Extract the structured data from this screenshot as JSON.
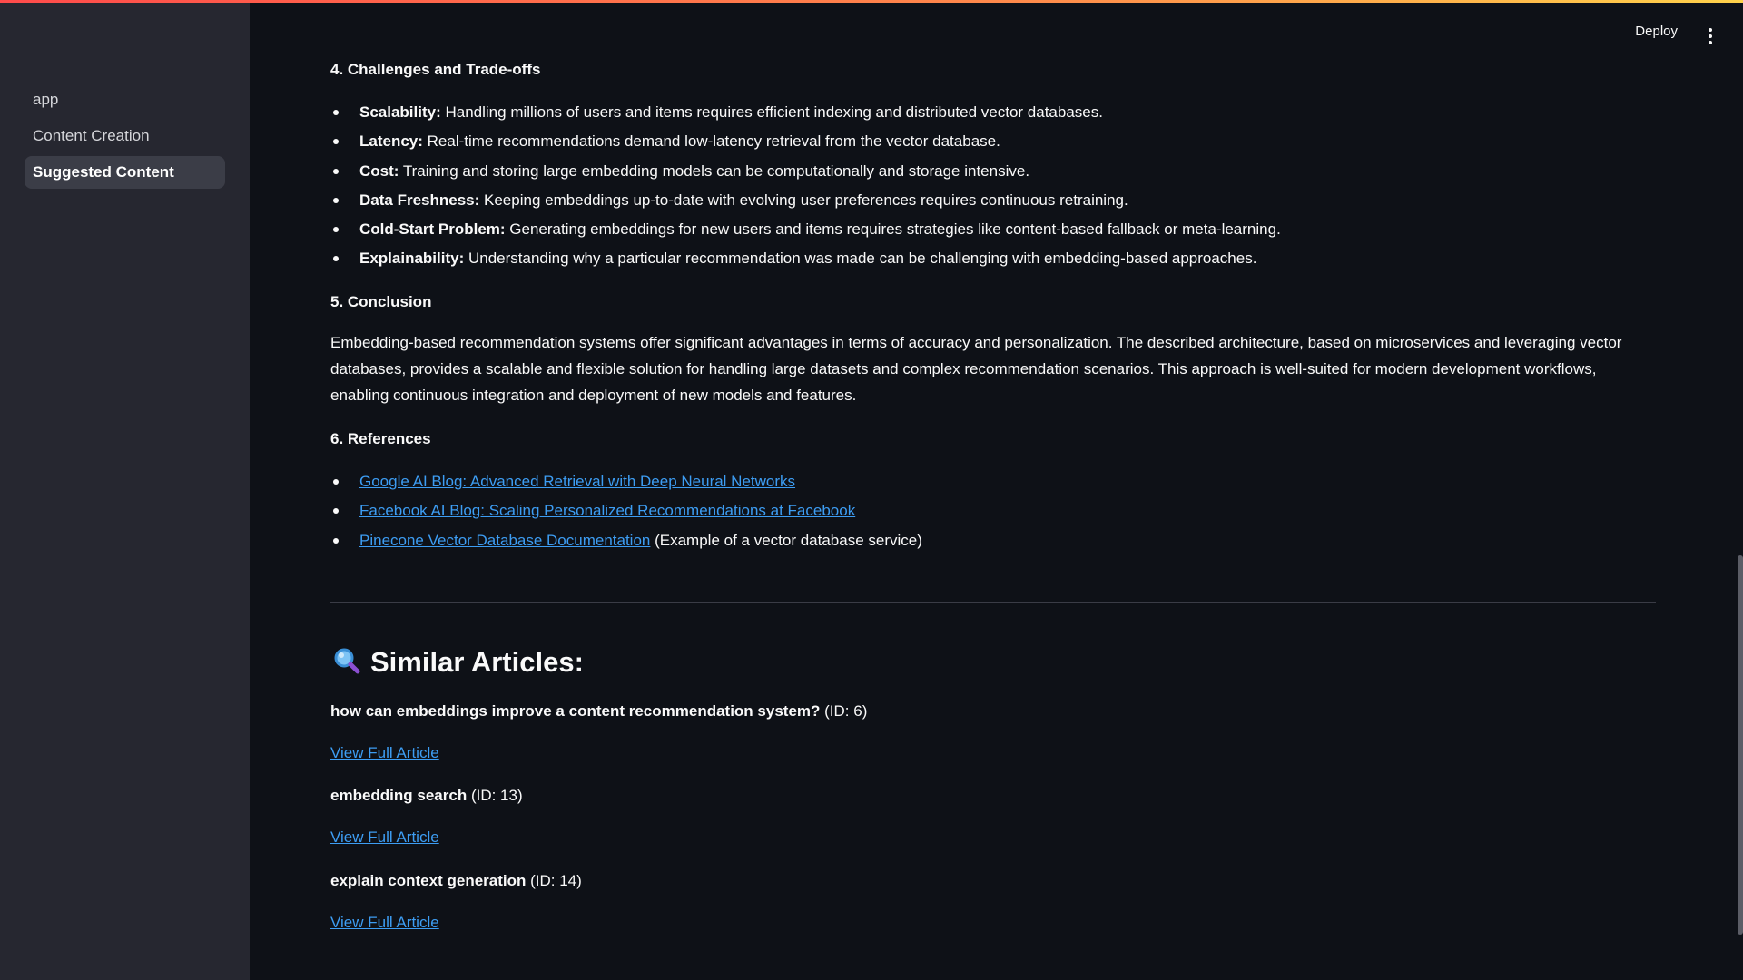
{
  "sidebar": {
    "items": [
      {
        "label": "app",
        "active": false
      },
      {
        "label": "Content Creation",
        "active": false
      },
      {
        "label": "Suggested Content",
        "active": true
      }
    ]
  },
  "header": {
    "deploy_label": "Deploy"
  },
  "sections": {
    "challenges": {
      "title": "4. Challenges and Trade-offs",
      "items": [
        {
          "term": "Scalability:",
          "text": " Handling millions of users and items requires efficient indexing and distributed vector databases."
        },
        {
          "term": "Latency:",
          "text": " Real-time recommendations demand low-latency retrieval from the vector database."
        },
        {
          "term": "Cost:",
          "text": " Training and storing large embedding models can be computationally and storage intensive."
        },
        {
          "term": "Data Freshness:",
          "text": " Keeping embeddings up-to-date with evolving user preferences requires continuous retraining."
        },
        {
          "term": "Cold-Start Problem:",
          "text": " Generating embeddings for new users and items requires strategies like content-based fallback or meta-learning."
        },
        {
          "term": "Explainability:",
          "text": " Understanding why a particular recommendation was made can be challenging with embedding-based approaches."
        }
      ]
    },
    "conclusion": {
      "title": "5. Conclusion",
      "text": "Embedding-based recommendation systems offer significant advantages in terms of accuracy and personalization. The described architecture, based on microservices and leveraging vector databases, provides a scalable and flexible solution for handling large datasets and complex recommendation scenarios. This approach is well-suited for modern development workflows, enabling continuous integration and deployment of new models and features."
    },
    "references": {
      "title": "6. References",
      "items": [
        {
          "link": "Google AI Blog: Advanced Retrieval with Deep Neural Networks",
          "suffix": ""
        },
        {
          "link": "Facebook AI Blog: Scaling Personalized Recommendations at Facebook",
          "suffix": ""
        },
        {
          "link": "Pinecone Vector Database Documentation",
          "suffix": " (Example of a vector database service)"
        }
      ]
    }
  },
  "similar": {
    "title": "Similar Articles:",
    "icon": "magnifying-glass-icon",
    "articles": [
      {
        "title": "how can embeddings improve a content recommendation system?",
        "id_text": " (ID: 6)",
        "link": "View Full Article"
      },
      {
        "title": "embedding search",
        "id_text": " (ID: 13)",
        "link": "View Full Article"
      },
      {
        "title": "explain context generation",
        "id_text": " (ID: 14)",
        "link": "View Full Article"
      }
    ]
  },
  "colors": {
    "background": "#0e1117",
    "sidebar": "#262730",
    "link": "#3d9df3",
    "accent": "#ff4b4b"
  }
}
